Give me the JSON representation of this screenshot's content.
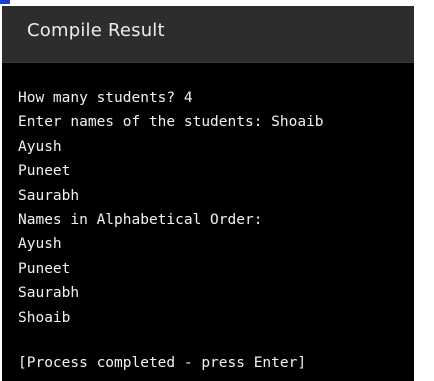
{
  "window": {
    "title": "Compile Result"
  },
  "console": {
    "lines": [
      "How many students? 4",
      "Enter names of the students: Shoaib",
      "Ayush",
      "Puneet",
      "Saurabh",
      "Names in Alphabetical Order:",
      "Ayush",
      "Puneet",
      "Saurabh",
      "Shoaib"
    ],
    "status": "[Process completed - press Enter]"
  },
  "colors": {
    "title_bar": "#2d2d2d",
    "console_background": "#000000",
    "console_text": "#f2f2f2",
    "accent": "#1b3fd6"
  }
}
